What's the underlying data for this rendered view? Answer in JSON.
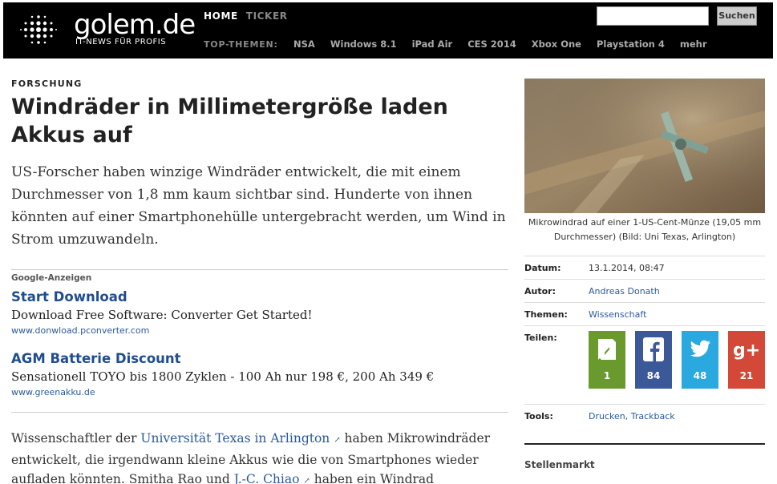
{
  "header": {
    "logo_text": "golem.de",
    "logo_sub": "IT-NEWS FÜR PROFIS",
    "nav": [
      "HOME",
      "TICKER"
    ],
    "topthemen_label": "TOP-THEMEN:",
    "topthemen": [
      "NSA",
      "Windows 8.1",
      "iPad Air",
      "CES 2014",
      "Xbox One",
      "Playstation 4",
      "mehr"
    ],
    "search": {
      "placeholder": "",
      "button_label": "Suchen"
    }
  },
  "article": {
    "kicker": "FORSCHUNG",
    "title": "Windräder in Millimetergröße laden Akkus auf",
    "lead": "US-Forscher haben winzige Windräder entwickelt, die mit einem Durchmesser von 1,8 mm kaum sichtbar sind. Hunderte von ihnen könnten auf einer Smartphonehülle untergebracht werden, um Wind in Strom umzuwandeln.",
    "body_start": "Wissenschaftler der ",
    "body_link1": "Universität Texas in Arlington",
    "body_mid": " haben Mikrowindräder entwickelt, die irgendwann kleine Akkus wie die von Smartphones wieder aufladen könnten. Smitha Rao und ",
    "body_link2": "J.-C. Chiao",
    "body_end": " haben ein Windrad"
  },
  "ads": {
    "label": "Google-Anzeigen",
    "items": [
      {
        "title": "Start Download",
        "text": "Download Free Software: Converter Get Started!",
        "url": "www.donwload.pconverter.com"
      },
      {
        "title": "AGM Batterie Discount",
        "text": "Sensationell TOYO bis 1800 Zyklen - 100 Ah nur 198 €, 200 Ah 349 €",
        "url": "www.greenakku.de"
      }
    ]
  },
  "sidebar": {
    "caption": "Mikrowindrad auf einer 1-US-Cent-Münze (19,05 mm Durchmesser) (Bild: Uni Texas, Arlington)",
    "meta": {
      "datum_label": "Datum:",
      "datum": "13.1.2014, 08:47",
      "autor_label": "Autor:",
      "autor": "Andreas Donath",
      "themen_label": "Themen:",
      "themen": "Wissenschaft",
      "teilen_label": "Teilen:",
      "tools_label": "Tools:",
      "tools": "Drucken, Trackback"
    },
    "share": [
      {
        "service": "other",
        "count": "1",
        "color": "#6a9a2e",
        "icon": "share-icon"
      },
      {
        "service": "facebook",
        "count": "84",
        "color": "#3b5998",
        "icon": "facebook-icon"
      },
      {
        "service": "twitter",
        "count": "48",
        "color": "#2aa9e0",
        "icon": "twitter-icon"
      },
      {
        "service": "googleplus",
        "count": "21",
        "color": "#d34836",
        "icon": "google-plus-icon"
      }
    ],
    "stellenmarkt": "Stellenmarkt"
  }
}
